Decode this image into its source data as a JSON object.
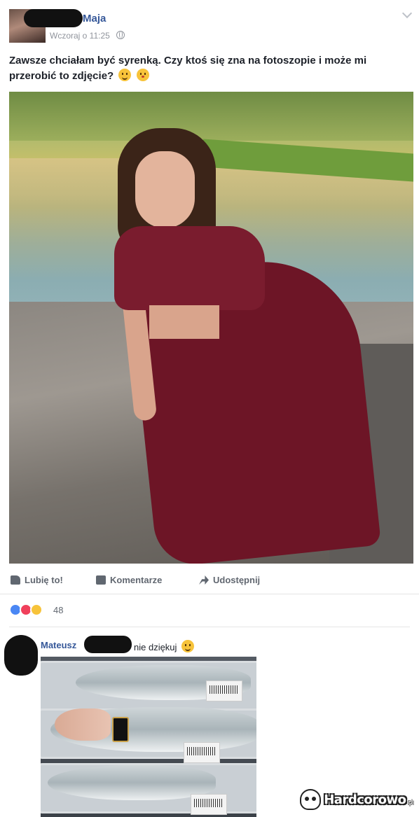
{
  "post": {
    "author": "Maja",
    "time": "Wczoraj o 11:25",
    "text": "Zawsze chciałam być syrenką. Czy ktoś się zna na fotoszopie i może mi przerobić to zdjęcie?"
  },
  "actions": {
    "like_label": "Lubię to!",
    "comment_label": "Komentarze",
    "share_label": "Udostępnij"
  },
  "reactions": {
    "count": "48"
  },
  "comment": {
    "author": "Mateusz",
    "text": "nie dziękuj"
  },
  "watermark": {
    "text": "Hardcorowo",
    "suffix": ".pl"
  },
  "icons": [
    "chevron-down-icon",
    "globe-icon",
    "like-icon",
    "comment-icon",
    "share-icon",
    "skull-icon"
  ],
  "colors": {
    "link": "#365899",
    "muted": "#90949c",
    "action": "#616770",
    "like_reaction": "#4a87f4",
    "love_reaction": "#f0405b",
    "haha_reaction": "#f7c33a"
  }
}
